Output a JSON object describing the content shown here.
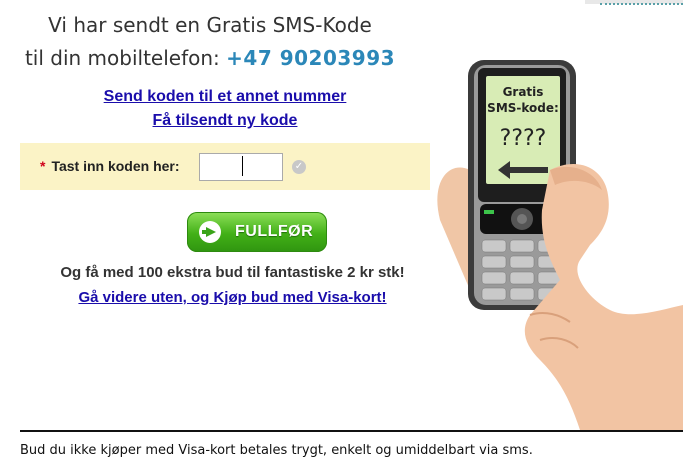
{
  "header": {
    "line1": "Vi har sendt en Gratis SMS-Kode",
    "line2_prefix": "til din mobiltelefon:",
    "phone_number": "+47 90203993"
  },
  "links": {
    "other_number": "Send koden til et annet nummer",
    "resend": "Få tilsendt ny kode"
  },
  "code_form": {
    "required_mark": "*",
    "label": "Tast inn koden her:",
    "value": ""
  },
  "submit": {
    "label": "FULLFØR"
  },
  "promo_text": "Og få med 100 ekstra bud til fantastiske 2 kr stk!",
  "visa_link": "Gå videre uten, og Kjøp bud med Visa-kort!",
  "phone_screen": {
    "line1": "Gratis",
    "line2": "SMS-kode:",
    "line3": "????"
  },
  "footer": {
    "text": "Bud du ikke kjøper med Visa-kort betales trygt, enkelt og umiddelbart via sms."
  }
}
